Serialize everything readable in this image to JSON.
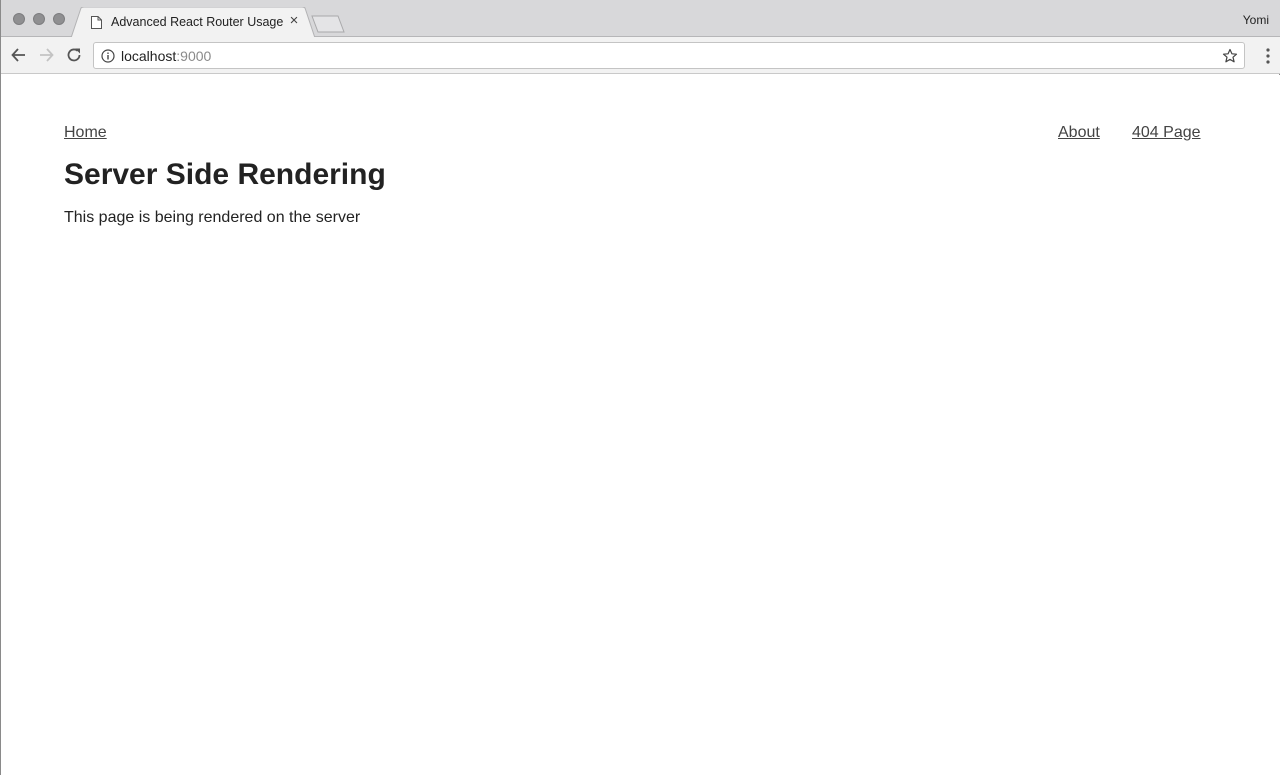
{
  "browser": {
    "tab": {
      "title": "Advanced React Router Usage",
      "close_glyph": "×"
    },
    "profile_name": "Yomi",
    "address_bar": {
      "host": "localhost",
      "port": ":9000"
    }
  },
  "page": {
    "nav": {
      "home": "Home",
      "about": "About",
      "not_found": "404 Page"
    },
    "title": "Server Side Rendering",
    "body_text": "This page is being rendered on the server"
  }
}
